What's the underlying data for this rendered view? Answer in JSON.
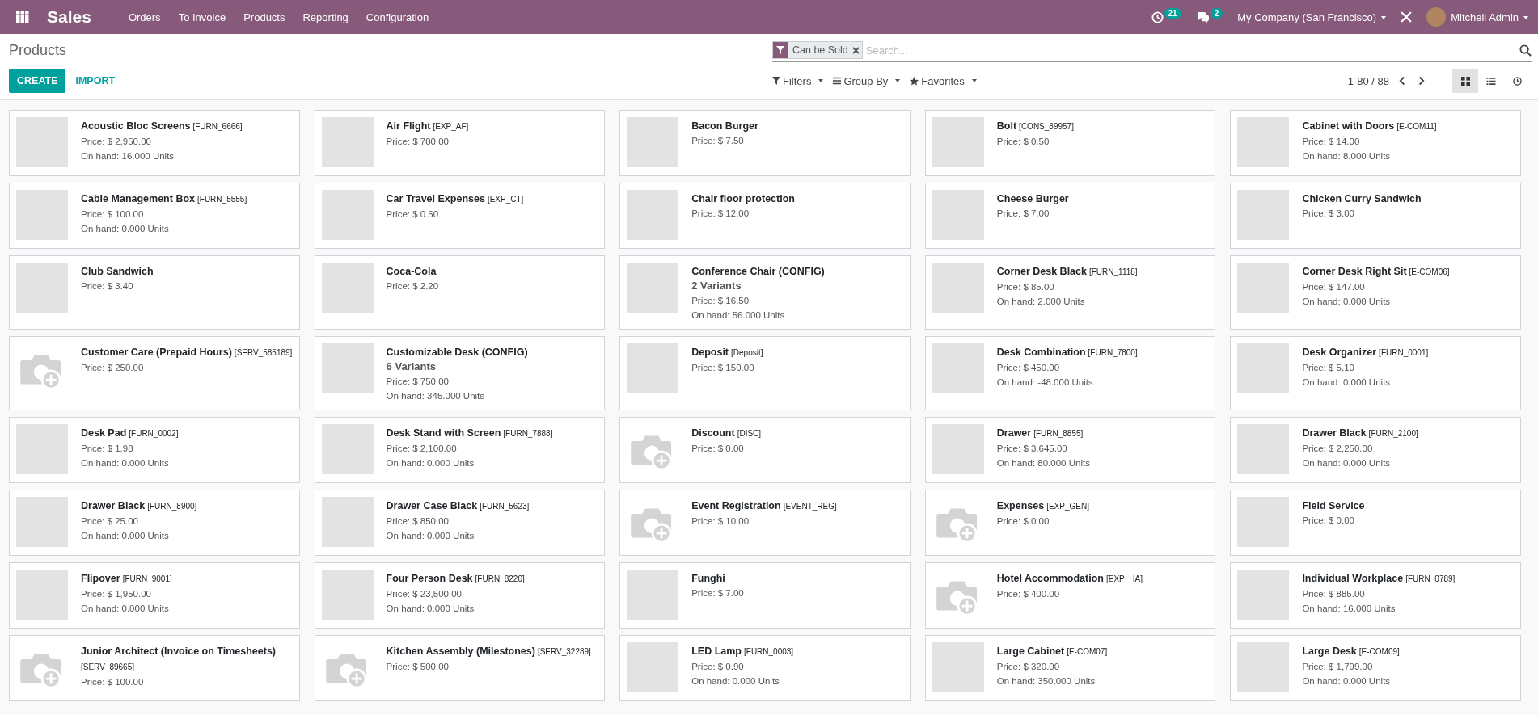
{
  "navbar": {
    "app_name": "Sales",
    "menu": [
      "Orders",
      "To Invoice",
      "Products",
      "Reporting",
      "Configuration"
    ],
    "activity_count": "21",
    "message_count": "2",
    "company": "My Company (San Francisco)",
    "user": "Mitchell Admin"
  },
  "control_panel": {
    "breadcrumb": "Products",
    "search": {
      "facets": [
        {
          "label": "Can be Sold"
        }
      ],
      "placeholder": "Search..."
    },
    "create_button": "CREATE",
    "import_button": "IMPORT",
    "search_options": [
      {
        "label": "Filters",
        "kind": "filter"
      },
      {
        "label": "Group By",
        "kind": "group"
      },
      {
        "label": "Favorites",
        "kind": "favorite"
      }
    ],
    "pager": "1-80 / 88",
    "views": [
      {
        "kind": "kanban",
        "selected": true
      },
      {
        "kind": "list",
        "selected": false
      },
      {
        "kind": "activity",
        "selected": false
      }
    ]
  },
  "products": [
    {
      "name": "Acoustic Bloc Screens",
      "ref": "[FURN_6666]",
      "price": "Price: $ 2,950.00",
      "on_hand": "On hand: 16.000 Units",
      "kind": "photo"
    },
    {
      "name": "Air Flight",
      "ref": "[EXP_AF]",
      "price": "Price: $ 700.00",
      "kind": "photo"
    },
    {
      "name": "Bacon Burger",
      "price": "Price: $ 7.50",
      "kind": "photo"
    },
    {
      "name": "Bolt",
      "ref": "[CONS_89957]",
      "price": "Price: $ 0.50",
      "kind": "photo"
    },
    {
      "name": "Cabinet with Doors",
      "ref": "[E-COM11]",
      "price": "Price: $ 14.00",
      "on_hand": "On hand: 8.000 Units",
      "kind": "photo"
    },
    {
      "name": "Cable Management Box",
      "ref": "[FURN_5555]",
      "price": "Price: $ 100.00",
      "on_hand": "On hand: 0.000 Units",
      "kind": "photo"
    },
    {
      "name": "Car Travel Expenses",
      "ref": "[EXP_CT]",
      "price": "Price: $ 0.50",
      "kind": "photo"
    },
    {
      "name": "Chair floor protection",
      "price": "Price: $ 12.00",
      "kind": "photo"
    },
    {
      "name": "Cheese Burger",
      "price": "Price: $ 7.00",
      "kind": "photo"
    },
    {
      "name": "Chicken Curry Sandwich",
      "price": "Price: $ 3.00",
      "kind": "photo"
    },
    {
      "name": "Club Sandwich",
      "price": "Price: $ 3.40",
      "kind": "photo"
    },
    {
      "name": "Coca-Cola",
      "price": "Price: $ 2.20",
      "kind": "photo"
    },
    {
      "name": "Conference Chair (CONFIG)",
      "variants": "2 Variants",
      "price": "Price: $ 16.50",
      "on_hand": "On hand: 56.000 Units",
      "kind": "photo"
    },
    {
      "name": "Corner Desk Black",
      "ref": "[FURN_1118]",
      "price": "Price: $ 85.00",
      "on_hand": "On hand: 2.000 Units",
      "kind": "photo"
    },
    {
      "name": "Corner Desk Right Sit",
      "ref": "[E-COM06]",
      "price": "Price: $ 147.00",
      "on_hand": "On hand: 0.000 Units",
      "kind": "photo"
    },
    {
      "name": "Customer Care (Prepaid Hours)",
      "ref": "[SERV_585189]",
      "price": "Price: $ 250.00",
      "kind": "no_image"
    },
    {
      "name": "Customizable Desk (CONFIG)",
      "variants": "6 Variants",
      "price": "Price: $ 750.00",
      "on_hand": "On hand: 345.000 Units",
      "kind": "photo"
    },
    {
      "name": "Deposit",
      "ref": "[Deposit]",
      "price": "Price: $ 150.00",
      "kind": "photo"
    },
    {
      "name": "Desk Combination",
      "ref": "[FURN_7800]",
      "price": "Price: $ 450.00",
      "on_hand": "On hand: -48.000 Units",
      "kind": "photo"
    },
    {
      "name": "Desk Organizer",
      "ref": "[FURN_0001]",
      "price": "Price: $ 5.10",
      "on_hand": "On hand: 0.000 Units",
      "kind": "photo"
    },
    {
      "name": "Desk Pad",
      "ref": "[FURN_0002]",
      "price": "Price: $ 1.98",
      "on_hand": "On hand: 0.000 Units",
      "kind": "photo"
    },
    {
      "name": "Desk Stand with Screen",
      "ref": "[FURN_7888]",
      "price": "Price: $ 2,100.00",
      "on_hand": "On hand: 0.000 Units",
      "kind": "photo"
    },
    {
      "name": "Discount",
      "ref": "[DISC]",
      "price": "Price: $ 0.00",
      "kind": "no_image"
    },
    {
      "name": "Drawer",
      "ref": "[FURN_8855]",
      "price": "Price: $ 3,645.00",
      "on_hand": "On hand: 80.000 Units",
      "kind": "photo"
    },
    {
      "name": "Drawer Black",
      "ref": "[FURN_2100]",
      "price": "Price: $ 2,250.00",
      "on_hand": "On hand: 0.000 Units",
      "kind": "photo"
    },
    {
      "name": "Drawer Black",
      "ref": "[FURN_8900]",
      "price": "Price: $ 25.00",
      "on_hand": "On hand: 0.000 Units",
      "kind": "photo"
    },
    {
      "name": "Drawer Case Black",
      "ref": "[FURN_5623]",
      "price": "Price: $ 850.00",
      "on_hand": "On hand: 0.000 Units",
      "kind": "photo"
    },
    {
      "name": "Event Registration",
      "ref": "[EVENT_REG]",
      "price": "Price: $ 10.00",
      "kind": "no_image"
    },
    {
      "name": "Expenses",
      "ref": "[EXP_GEN]",
      "price": "Price: $ 0.00",
      "kind": "no_image"
    },
    {
      "name": "Field Service",
      "price": "Price: $ 0.00",
      "kind": "photo"
    },
    {
      "name": "Flipover",
      "ref": "[FURN_9001]",
      "price": "Price: $ 1,950.00",
      "on_hand": "On hand: 0.000 Units",
      "kind": "photo"
    },
    {
      "name": "Four Person Desk",
      "ref": "[FURN_8220]",
      "price": "Price: $ 23,500.00",
      "on_hand": "On hand: 0.000 Units",
      "kind": "photo"
    },
    {
      "name": "Funghi",
      "price": "Price: $ 7.00",
      "kind": "photo"
    },
    {
      "name": "Hotel Accommodation",
      "ref": "[EXP_HA]",
      "price": "Price: $ 400.00",
      "kind": "no_image"
    },
    {
      "name": "Individual Workplace",
      "ref": "[FURN_0789]",
      "price": "Price: $ 885.00",
      "on_hand": "On hand: 16.000 Units",
      "kind": "photo"
    },
    {
      "name": "Junior Architect (Invoice on Timesheets)",
      "ref": "[SERV_89665]",
      "price": "Price: $ 100.00",
      "kind": "no_image"
    },
    {
      "name": "Kitchen Assembly (Milestones)",
      "ref": "[SERV_32289]",
      "price": "Price: $ 500.00",
      "kind": "no_image"
    },
    {
      "name": "LED Lamp",
      "ref": "[FURN_0003]",
      "price": "Price: $ 0.90",
      "on_hand": "On hand: 0.000 Units",
      "kind": "photo"
    },
    {
      "name": "Large Cabinet",
      "ref": "[E-COM07]",
      "price": "Price: $ 320.00",
      "on_hand": "On hand: 350.000 Units",
      "kind": "photo"
    },
    {
      "name": "Large Desk",
      "ref": "[E-COM09]",
      "price": "Price: $ 1,799.00",
      "on_hand": "On hand: 0.000 Units",
      "kind": "photo"
    }
  ]
}
